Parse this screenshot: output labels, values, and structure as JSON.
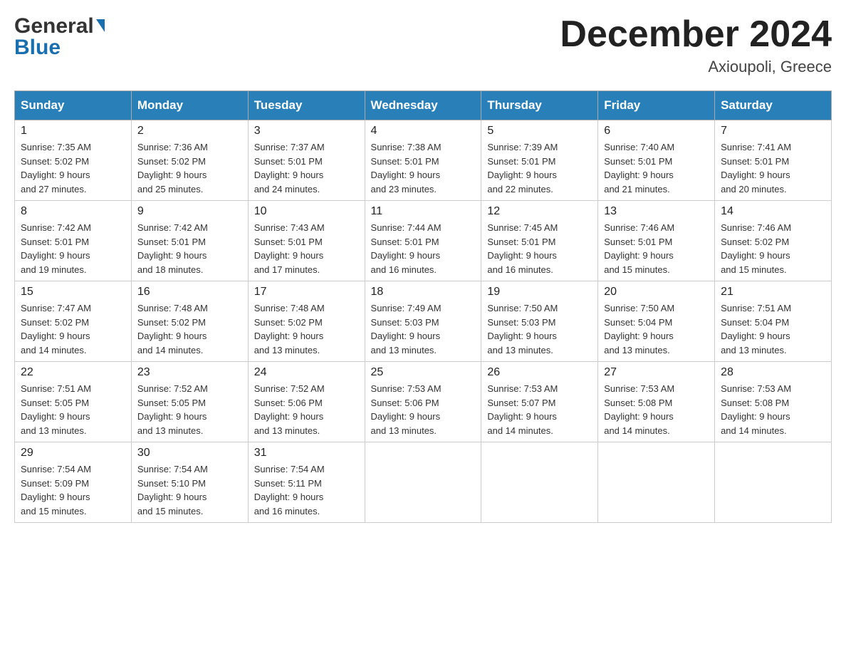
{
  "header": {
    "logo_general": "General",
    "logo_blue": "Blue",
    "month_title": "December 2024",
    "location": "Axioupoli, Greece"
  },
  "weekdays": [
    "Sunday",
    "Monday",
    "Tuesday",
    "Wednesday",
    "Thursday",
    "Friday",
    "Saturday"
  ],
  "weeks": [
    [
      {
        "day": "1",
        "sunrise": "7:35 AM",
        "sunset": "5:02 PM",
        "daylight": "9 hours and 27 minutes."
      },
      {
        "day": "2",
        "sunrise": "7:36 AM",
        "sunset": "5:02 PM",
        "daylight": "9 hours and 25 minutes."
      },
      {
        "day": "3",
        "sunrise": "7:37 AM",
        "sunset": "5:01 PM",
        "daylight": "9 hours and 24 minutes."
      },
      {
        "day": "4",
        "sunrise": "7:38 AM",
        "sunset": "5:01 PM",
        "daylight": "9 hours and 23 minutes."
      },
      {
        "day": "5",
        "sunrise": "7:39 AM",
        "sunset": "5:01 PM",
        "daylight": "9 hours and 22 minutes."
      },
      {
        "day": "6",
        "sunrise": "7:40 AM",
        "sunset": "5:01 PM",
        "daylight": "9 hours and 21 minutes."
      },
      {
        "day": "7",
        "sunrise": "7:41 AM",
        "sunset": "5:01 PM",
        "daylight": "9 hours and 20 minutes."
      }
    ],
    [
      {
        "day": "8",
        "sunrise": "7:42 AM",
        "sunset": "5:01 PM",
        "daylight": "9 hours and 19 minutes."
      },
      {
        "day": "9",
        "sunrise": "7:42 AM",
        "sunset": "5:01 PM",
        "daylight": "9 hours and 18 minutes."
      },
      {
        "day": "10",
        "sunrise": "7:43 AM",
        "sunset": "5:01 PM",
        "daylight": "9 hours and 17 minutes."
      },
      {
        "day": "11",
        "sunrise": "7:44 AM",
        "sunset": "5:01 PM",
        "daylight": "9 hours and 16 minutes."
      },
      {
        "day": "12",
        "sunrise": "7:45 AM",
        "sunset": "5:01 PM",
        "daylight": "9 hours and 16 minutes."
      },
      {
        "day": "13",
        "sunrise": "7:46 AM",
        "sunset": "5:01 PM",
        "daylight": "9 hours and 15 minutes."
      },
      {
        "day": "14",
        "sunrise": "7:46 AM",
        "sunset": "5:02 PM",
        "daylight": "9 hours and 15 minutes."
      }
    ],
    [
      {
        "day": "15",
        "sunrise": "7:47 AM",
        "sunset": "5:02 PM",
        "daylight": "9 hours and 14 minutes."
      },
      {
        "day": "16",
        "sunrise": "7:48 AM",
        "sunset": "5:02 PM",
        "daylight": "9 hours and 14 minutes."
      },
      {
        "day": "17",
        "sunrise": "7:48 AM",
        "sunset": "5:02 PM",
        "daylight": "9 hours and 13 minutes."
      },
      {
        "day": "18",
        "sunrise": "7:49 AM",
        "sunset": "5:03 PM",
        "daylight": "9 hours and 13 minutes."
      },
      {
        "day": "19",
        "sunrise": "7:50 AM",
        "sunset": "5:03 PM",
        "daylight": "9 hours and 13 minutes."
      },
      {
        "day": "20",
        "sunrise": "7:50 AM",
        "sunset": "5:04 PM",
        "daylight": "9 hours and 13 minutes."
      },
      {
        "day": "21",
        "sunrise": "7:51 AM",
        "sunset": "5:04 PM",
        "daylight": "9 hours and 13 minutes."
      }
    ],
    [
      {
        "day": "22",
        "sunrise": "7:51 AM",
        "sunset": "5:05 PM",
        "daylight": "9 hours and 13 minutes."
      },
      {
        "day": "23",
        "sunrise": "7:52 AM",
        "sunset": "5:05 PM",
        "daylight": "9 hours and 13 minutes."
      },
      {
        "day": "24",
        "sunrise": "7:52 AM",
        "sunset": "5:06 PM",
        "daylight": "9 hours and 13 minutes."
      },
      {
        "day": "25",
        "sunrise": "7:53 AM",
        "sunset": "5:06 PM",
        "daylight": "9 hours and 13 minutes."
      },
      {
        "day": "26",
        "sunrise": "7:53 AM",
        "sunset": "5:07 PM",
        "daylight": "9 hours and 14 minutes."
      },
      {
        "day": "27",
        "sunrise": "7:53 AM",
        "sunset": "5:08 PM",
        "daylight": "9 hours and 14 minutes."
      },
      {
        "day": "28",
        "sunrise": "7:53 AM",
        "sunset": "5:08 PM",
        "daylight": "9 hours and 14 minutes."
      }
    ],
    [
      {
        "day": "29",
        "sunrise": "7:54 AM",
        "sunset": "5:09 PM",
        "daylight": "9 hours and 15 minutes."
      },
      {
        "day": "30",
        "sunrise": "7:54 AM",
        "sunset": "5:10 PM",
        "daylight": "9 hours and 15 minutes."
      },
      {
        "day": "31",
        "sunrise": "7:54 AM",
        "sunset": "5:11 PM",
        "daylight": "9 hours and 16 minutes."
      },
      null,
      null,
      null,
      null
    ]
  ],
  "labels": {
    "sunrise": "Sunrise:",
    "sunset": "Sunset:",
    "daylight": "Daylight:"
  }
}
